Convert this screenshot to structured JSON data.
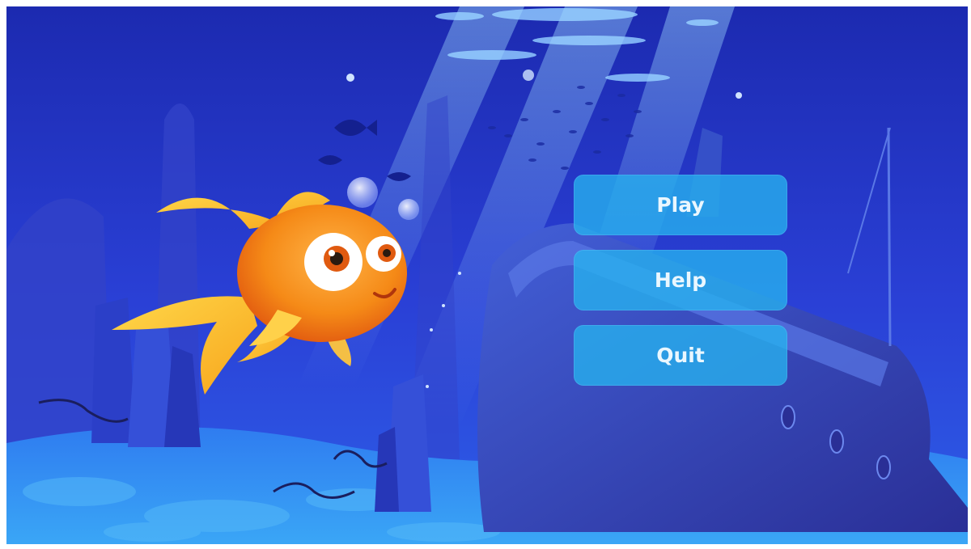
{
  "menu": {
    "buttons": [
      {
        "label": "Play"
      },
      {
        "label": "Help"
      },
      {
        "label": "Quit"
      }
    ]
  },
  "colors": {
    "sea_top": "#1c2ab0",
    "sea_mid": "#2a44d8",
    "seafloor": "#2f8ff0",
    "button_fill": "#26b2ee",
    "button_text": "#eaf7ff",
    "fish": "#f59a1a",
    "fin": "#ffc531"
  },
  "icons": {
    "fish": "goldfish-character",
    "ship": "sunken-ship",
    "bubbles": "air-bubbles"
  }
}
